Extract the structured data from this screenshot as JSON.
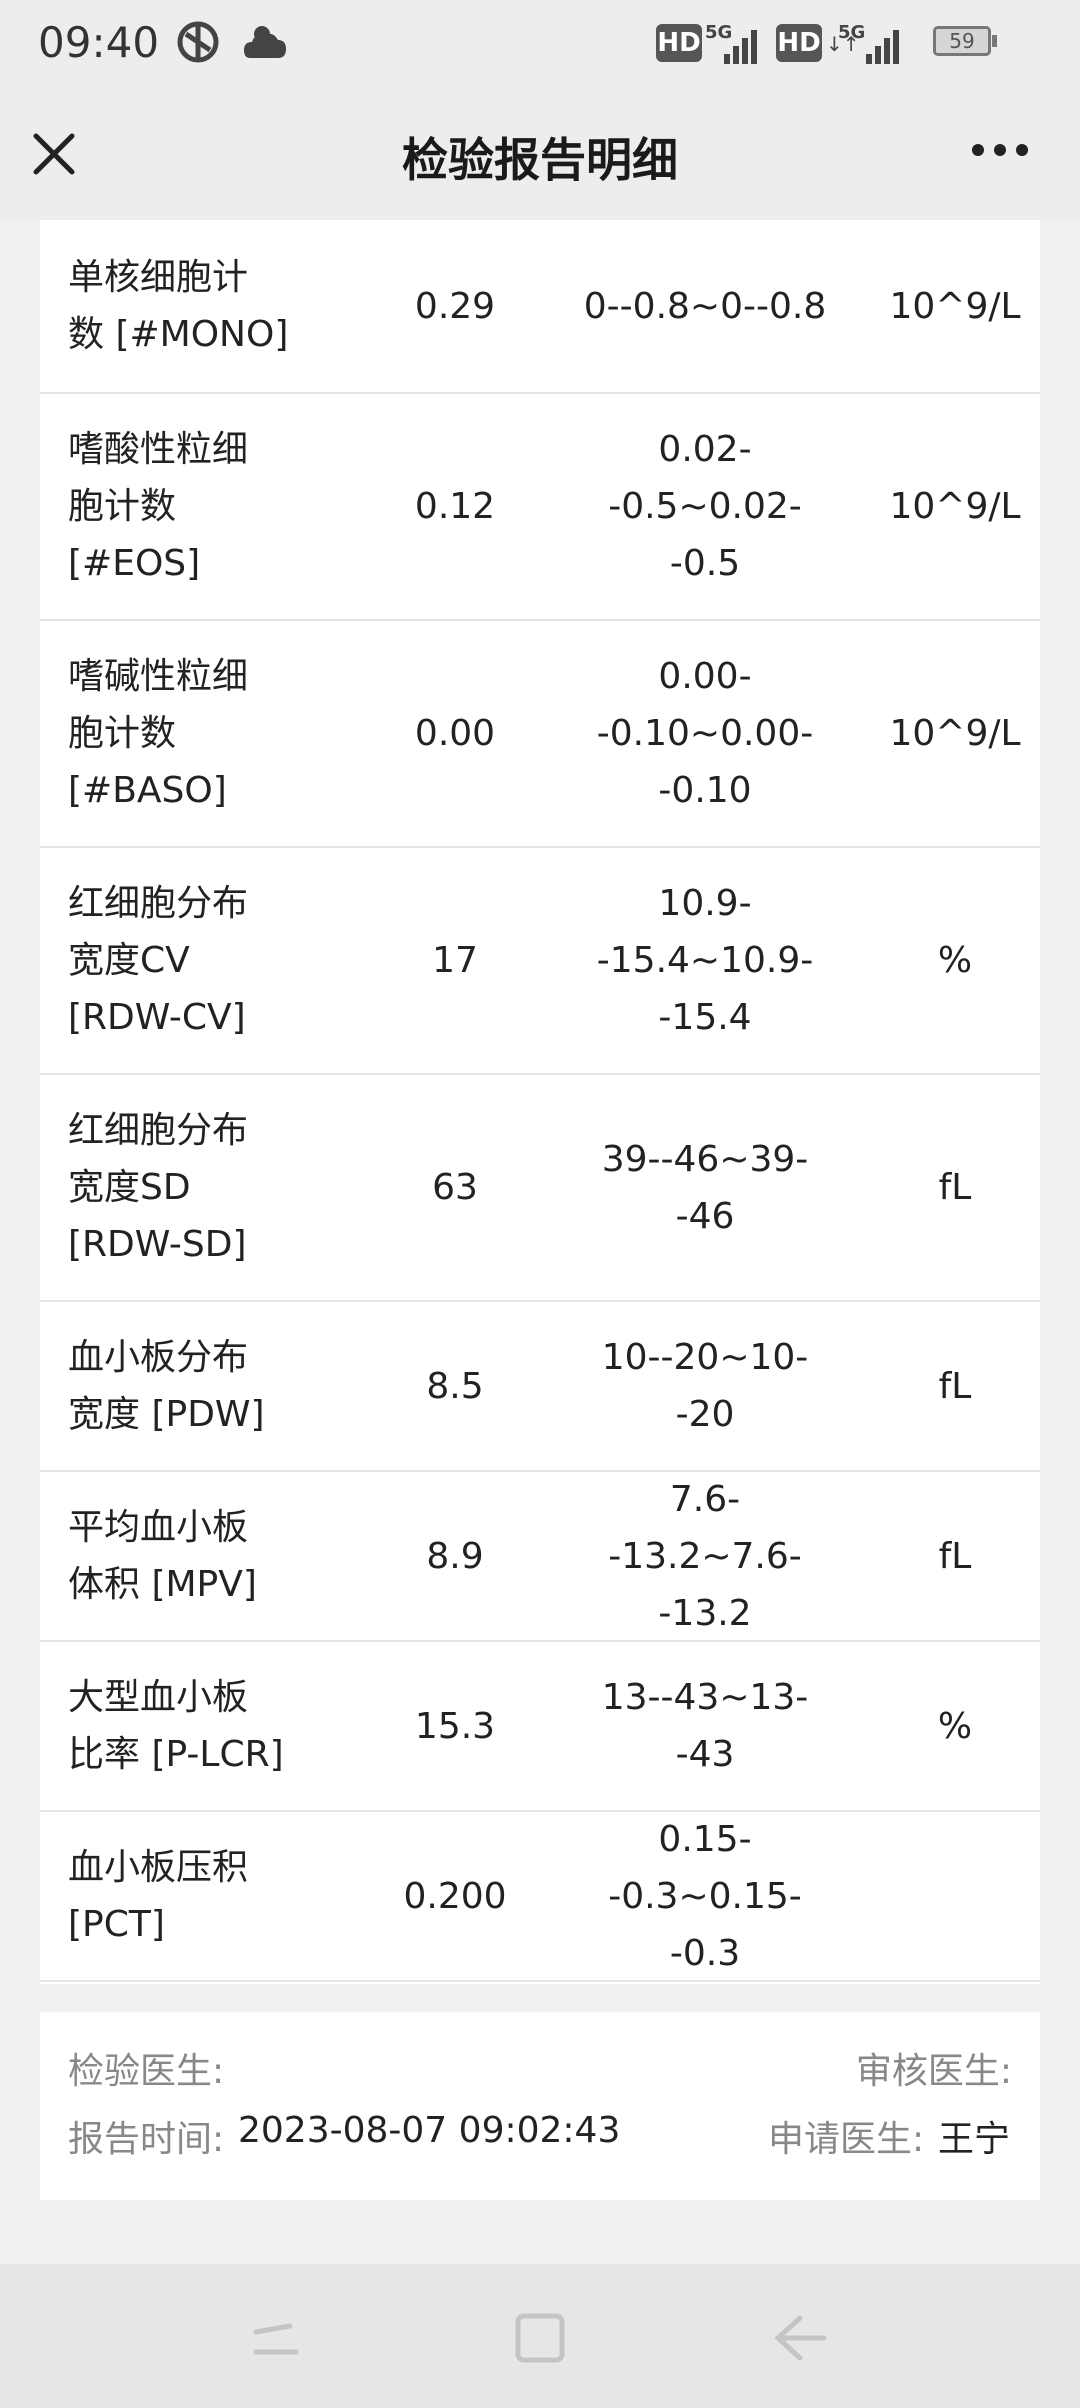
{
  "status_bar": {
    "time": "09:40",
    "icons": [
      "vpn-icon",
      "cloud-icon",
      "signal-icon",
      "battery-icon"
    ],
    "network1": "HD",
    "network1_gen": "5G",
    "network2": "HD",
    "network2_gen": "5G",
    "battery": "59"
  },
  "header": {
    "title": "检验报告明细"
  },
  "rows": [
    {
      "name": "单核细胞计\n数 [#MONO]",
      "value": "0.29",
      "ref": "0--0.8~0--0.8",
      "unit": "10^9/L"
    },
    {
      "name": "嗜酸性粒细\n胞计数\n[#EOS]",
      "value": "0.12",
      "ref": "0.02-\n-0.5~0.02--0.5",
      "unit": "10^9/L"
    },
    {
      "name": "嗜碱性粒细\n胞计数\n[#BASO]",
      "value": "0.00",
      "ref": "0.00-\n-0.10~0.00-\n-0.10",
      "unit": "10^9/L"
    },
    {
      "name": "红细胞分布\n宽度CV\n[RDW-CV]",
      "value": "17",
      "ref": "10.9-\n-15.4~10.9-\n-15.4",
      "unit": "%"
    },
    {
      "name": "红细胞分布\n宽度SD\n[RDW-SD]",
      "value": "63",
      "ref": "39--46~39--46",
      "unit": "fL"
    },
    {
      "name": "血小板分布\n宽度 [PDW]",
      "value": "8.5",
      "ref": "10--20~10--20",
      "unit": "fL"
    },
    {
      "name": "平均血小板\n体积 [MPV]",
      "value": "8.9",
      "ref": "7.6--13.2~7.6-\n-13.2",
      "unit": "fL"
    },
    {
      "name": "大型血小板\n比率 [P-LCR]",
      "value": "15.3",
      "ref": "13--43~13--43",
      "unit": "%"
    },
    {
      "name": "血小板压积\n[PCT]",
      "value": "0.200",
      "ref": "0.15-\n-0.3~0.15--0.3",
      "unit": ""
    }
  ],
  "footer": {
    "examiner_label": "检验医生:",
    "reviewer_label": "审核医生:",
    "report_time_label": "报告时间:",
    "report_time": "2023-08-07 09:02:43",
    "requester_label": "申请医生:",
    "requester": "王宁"
  }
}
